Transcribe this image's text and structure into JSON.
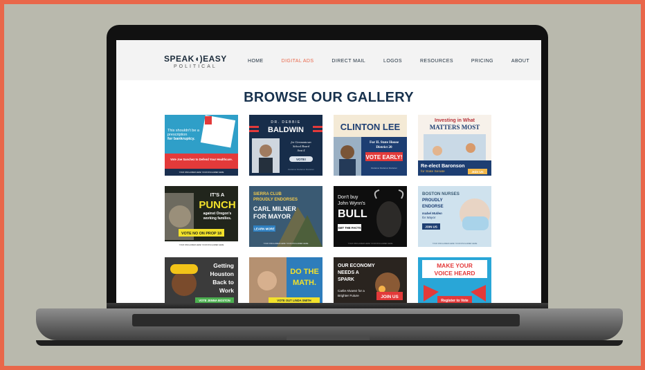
{
  "site": {
    "logo": {
      "main": "SPEAK◖)EASY",
      "sub": "POLITICAL"
    },
    "nav": [
      {
        "label": "HOME",
        "active": false
      },
      {
        "label": "DIGITAL ADS",
        "active": true
      },
      {
        "label": "DIRECT MAIL",
        "active": false
      },
      {
        "label": "LOGOS",
        "active": false
      },
      {
        "label": "RESOURCES",
        "active": false
      },
      {
        "label": "PRICING",
        "active": false
      },
      {
        "label": "ABOUT",
        "active": false
      }
    ],
    "gallery_title": "BROWSE OUR GALLERY"
  },
  "gallery": [
    {
      "id": "bankruptcy",
      "bg": "#2f9fc8",
      "lines": [
        "This shouldn't be a",
        "prescription",
        "for bankruptcy."
      ],
      "cta": "Vote Joe Sanchez to Defend Your Healthcare.",
      "footer": "YOUR DISCLAIMER HERE YOUR DISCLAIMER HERE"
    },
    {
      "id": "baldwin",
      "bg": "#172d4a",
      "lines": [
        "DR. DEBBIE",
        "BALDWIN",
        "for Germantown",
        "School Board",
        "Seat 4"
      ],
      "cta": "VOTE!",
      "footer": "Disclaimer Disclaimer Disclaimer"
    },
    {
      "id": "clinton",
      "bg": "#1d3e72",
      "lines": [
        "CLINTON LEE",
        "For IL State House",
        "District 20"
      ],
      "cta": "VOTE EARLY!",
      "footer": "Disclaimer Disclaimer Disclaimer"
    },
    {
      "id": "baronson",
      "bg": "#f7f1ea",
      "lines": [
        "Investing in What",
        "MATTERS MOST"
      ],
      "cta": "Re-elect Baronson",
      "sub": "for State Senate",
      "button": "Join Us"
    },
    {
      "id": "punch",
      "bg": "#21251c",
      "lines": [
        "IT'S A",
        "PUNCH",
        "against Oregon's",
        "working families."
      ],
      "cta": "VOTE NO ON PROP 18",
      "footer": "YOUR DISCLAIMER HERE YOUR DISCLAIMER HERE"
    },
    {
      "id": "milner",
      "bg": "#3a5a73",
      "lines": [
        "SIERRA CLUB",
        "PROUDLY ENDORSES",
        "CARL MILNER",
        "FOR MAYOR"
      ],
      "cta": "LEARN MORE",
      "footer": "YOUR DISCLAIMER HERE YOUR DISCLAIMER HERE"
    },
    {
      "id": "bull",
      "bg": "#0e0e0e",
      "lines": [
        "Don't buy",
        "John Wynn's",
        "BULL"
      ],
      "cta": "GET THE FACTS",
      "footer": "YOUR DISCLAIMER HERE YOUR DISCLAIMER HERE"
    },
    {
      "id": "nurses",
      "bg": "#cfe2ee",
      "lines": [
        "BOSTON NURSES",
        "PROUDLY",
        "ENDORSE",
        "Isabel Mullen",
        "for Mayor"
      ],
      "cta": "JOIN US",
      "footer": "YOUR DISCLAIMER HERE YOUR DISCLAIMER HERE"
    },
    {
      "id": "houston",
      "bg": "#3b3b3b",
      "lines": [
        "Getting",
        "Houston",
        "Back to",
        "Work"
      ],
      "cta": "VOTE JENNA BOSTON"
    },
    {
      "id": "math",
      "bg": "#2e7dbb",
      "lines": [
        "DO THE",
        "MATH."
      ],
      "cta": "VOTE OUT LINDA SMITH"
    },
    {
      "id": "economy",
      "bg": "#2a241f",
      "lines": [
        "OUR ECONOMY",
        "NEEDS A",
        "SPARK",
        "Carlie Alvarez for a",
        "Brighter Future"
      ],
      "cta": "JOIN US"
    },
    {
      "id": "voice",
      "bg": "#29a6d7",
      "lines": [
        "MAKE YOUR",
        "VOICE HEARD"
      ],
      "cta": "Register to Vote"
    }
  ]
}
